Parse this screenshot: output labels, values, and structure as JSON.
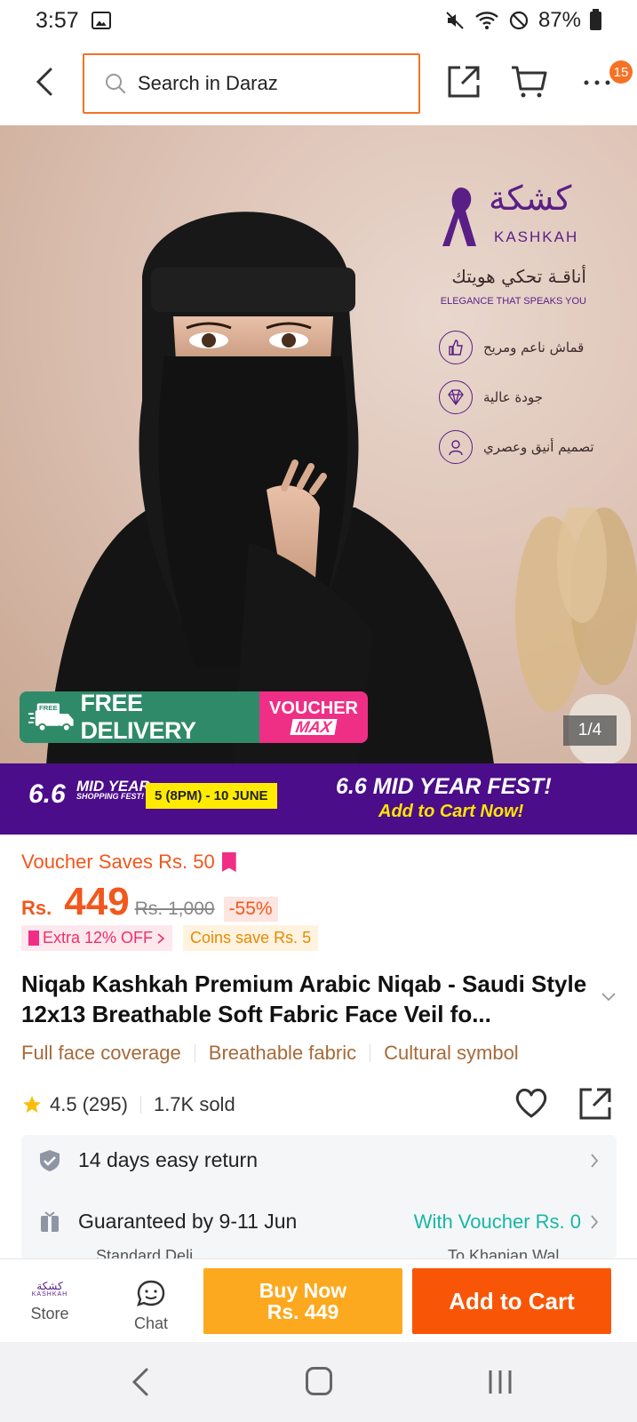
{
  "status_bar": {
    "time": "3:57",
    "battery": "87%",
    "icons": [
      "image-icon",
      "mute-icon",
      "wifi-icon",
      "dnd-icon",
      "battery-icon"
    ]
  },
  "header": {
    "search_placeholder": "Search in Daraz",
    "cart_badge": "15",
    "icons": [
      "back-icon",
      "search-icon",
      "share-icon",
      "cart-icon",
      "more-icon"
    ]
  },
  "hero": {
    "brand_ar": "كشكة",
    "brand_en": "KASHKAH",
    "tagline_ar": "أناقـة تحكي هويتك",
    "tagline_en": "ELEGANCE THAT SPEAKS YOU",
    "features": [
      {
        "icon": "thumbs-up-icon",
        "text": "قماش ناعم ومريح"
      },
      {
        "icon": "diamond-icon",
        "text": "جودة عالية"
      },
      {
        "icon": "person-icon",
        "text": "تصميم أنيق وعصري"
      }
    ],
    "delivery": {
      "free_badge": "FREE",
      "label": "FREE DELIVERY",
      "voucher_top": "VOUCHER",
      "voucher_bottom": "MAX"
    },
    "counter": "1/4"
  },
  "promo": {
    "number": "6.6",
    "mid_year": "MID YEAR",
    "shopping_fest": "SHOPPING FEST!",
    "date": "5 (8PM) - 10 JUNE",
    "title": "6.6 MID YEAR FEST!",
    "subtitle": "Add to Cart Now!"
  },
  "pricing": {
    "voucher_saves": "Voucher Saves Rs. 50",
    "currency": "Rs.",
    "price": "449",
    "original_price": "Rs. 1,000",
    "discount": "-55%",
    "extra_off": "Extra 12% OFF",
    "coins": "Coins save Rs. 5"
  },
  "product": {
    "title": "Niqab Kashkah Premium Arabic Niqab - Saudi Style 12x13 Breathable Soft Fabric Face Veil fo...",
    "feature_tags": [
      "Full face coverage",
      "Breathable fabric",
      "Cultural symbol"
    ],
    "rating": "4.5",
    "reviews": "(295)",
    "sold": "1.7K sold"
  },
  "services": {
    "return": "14 days easy return",
    "delivery": "Guaranteed by 9-11 Jun",
    "voucher": "With Voucher Rs. 0",
    "delivery_sub": "Standard Deli...",
    "delivery_sub2": "To Khanian Wal..."
  },
  "bottom_bar": {
    "store_label": "Store",
    "store_logo_ar": "كشكة",
    "store_logo_en": "KASHKAH",
    "chat_label": "Chat",
    "buy_now_line1": "Buy Now",
    "buy_now_line2": "Rs. 449",
    "add_to_cart": "Add to Cart"
  },
  "colors": {
    "accent": "#f57224",
    "buy_now": "#fca91f",
    "add_to_cart": "#f85606",
    "promo_bg": "#4b0d8a",
    "delivery_green": "#2f8a6a",
    "voucher_pink": "#ef2f86",
    "teal": "#16b7a6"
  }
}
